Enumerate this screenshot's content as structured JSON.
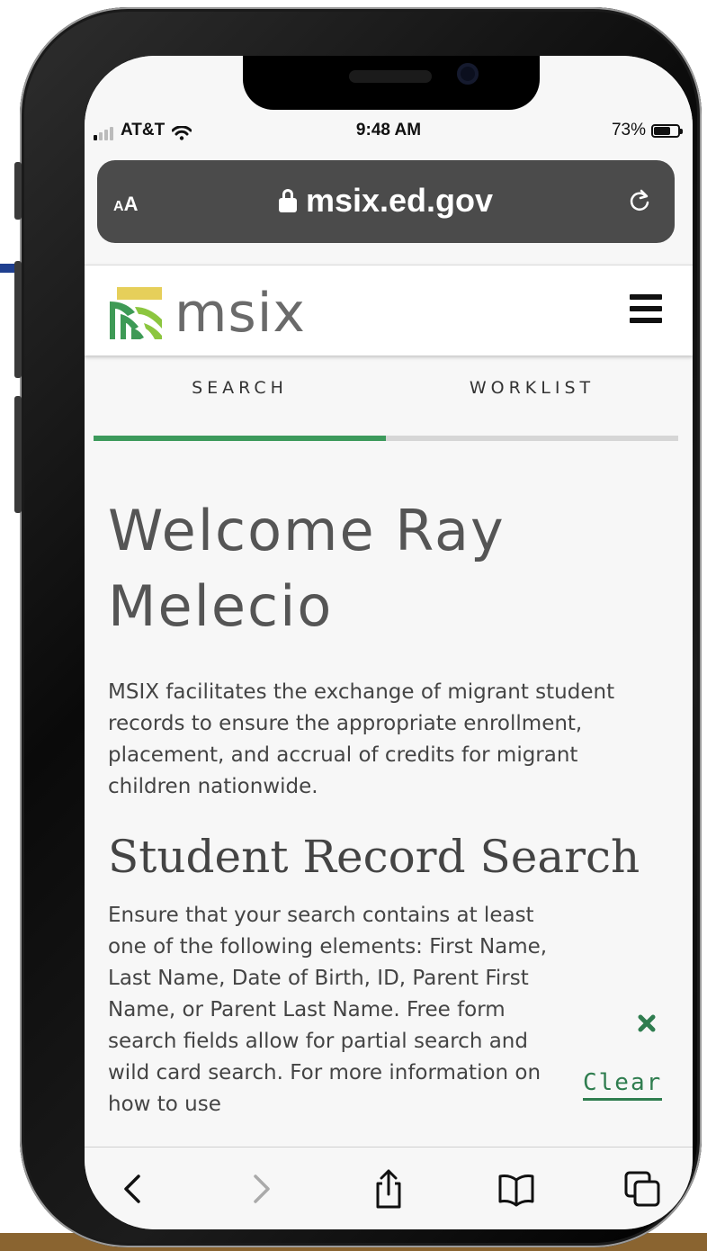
{
  "status_bar": {
    "carrier": "AT&T",
    "time": "9:48 AM",
    "battery_percent": "73%",
    "battery_level": 0.73
  },
  "browser": {
    "text_size_label": "AA",
    "url": "msix.ed.gov",
    "lock_icon": "lock-icon",
    "reload_icon": "reload-icon"
  },
  "site": {
    "logo_text": "msix",
    "menu_icon": "hamburger-menu-icon",
    "tabs": [
      {
        "label": "SEARCH",
        "active": true
      },
      {
        "label": "WORKLIST",
        "active": false
      }
    ],
    "accent_color": "#3d9a5c"
  },
  "content": {
    "welcome_heading": "Welcome Ray Melecio",
    "intro": "MSIX facilitates the exchange of migrant student records to ensure the appropriate enrollment, placement, and accrual of credits for migrant children nationwide.",
    "section_title": "Student Record Search",
    "search_help": "Ensure that your search contains at least one of the following elements: First Name, Last Name, Date of Birth, ID, Parent First Name, or Parent Last Name. Free form search fields allow for partial search and wild card search. For more information on how to use",
    "clear_label": "Clear"
  },
  "toolbar": {
    "icons": [
      "back-icon",
      "forward-icon",
      "share-icon",
      "bookmarks-icon",
      "tabs-icon"
    ]
  }
}
